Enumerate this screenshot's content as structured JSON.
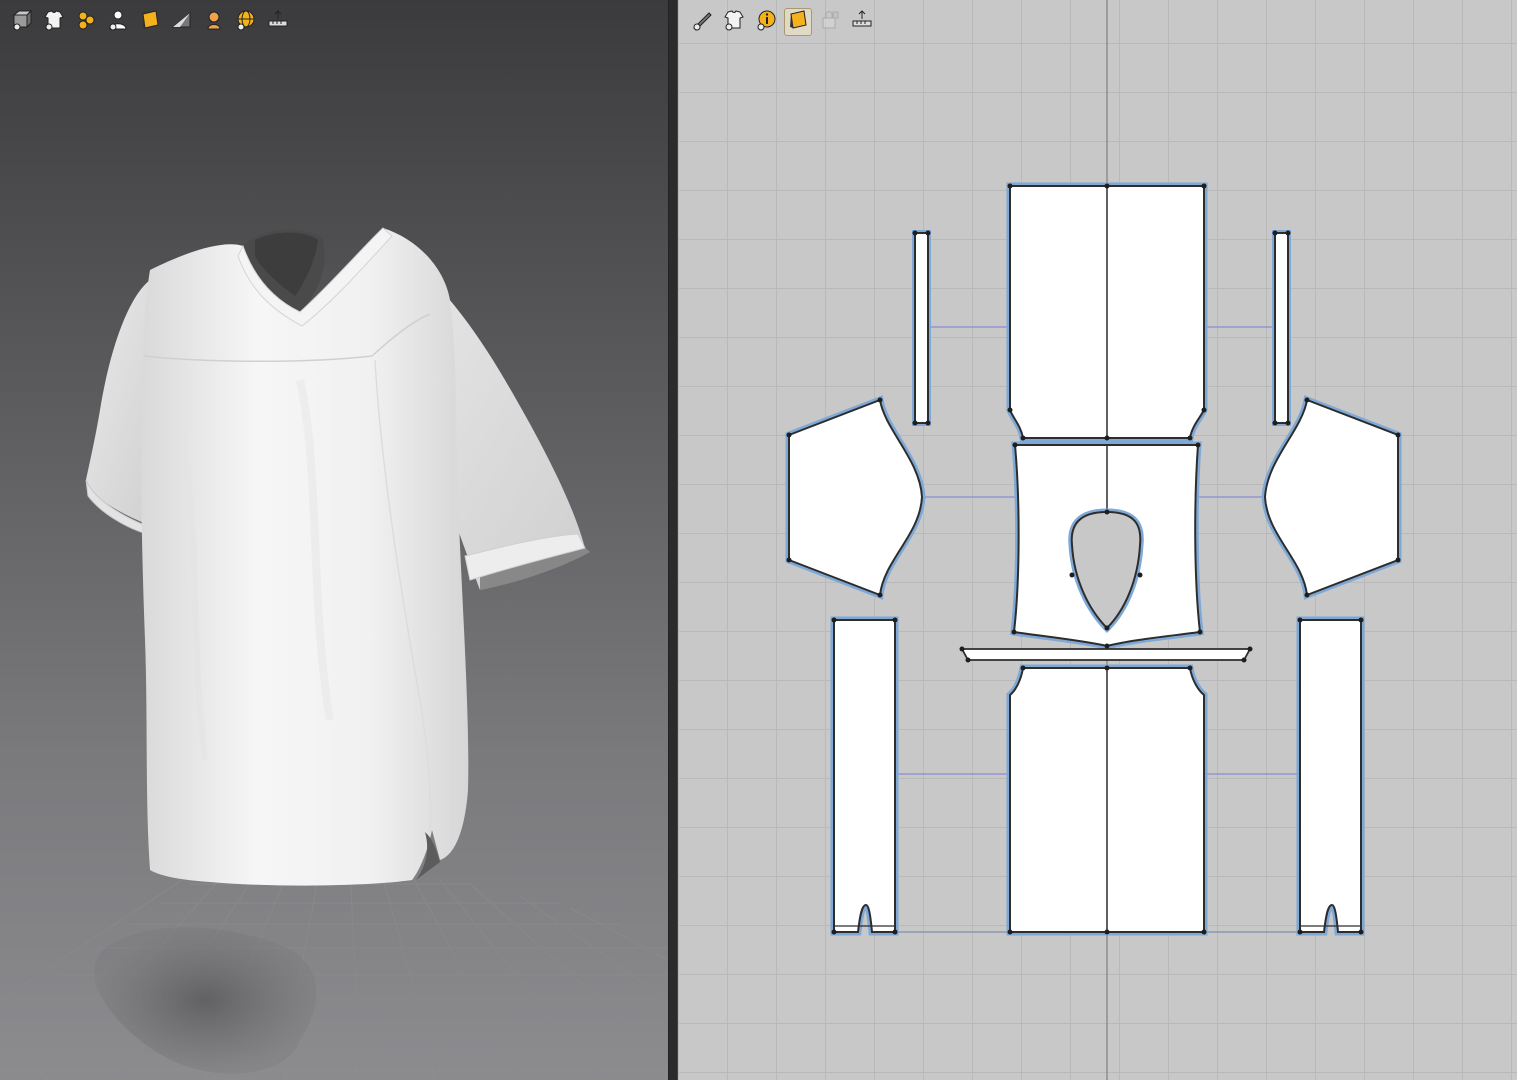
{
  "viewport_3d": {
    "toolbar": [
      {
        "icon": "cube-display-icon"
      },
      {
        "icon": "shirt-visibility-icon"
      },
      {
        "icon": "pin-points-icon"
      },
      {
        "icon": "avatar-visibility-icon"
      },
      {
        "icon": "texture-display-icon"
      },
      {
        "icon": "surface-render-icon"
      },
      {
        "icon": "avatar-head-icon"
      },
      {
        "icon": "wireframe-globe-icon"
      },
      {
        "icon": "ruler-measure-icon"
      }
    ],
    "background_color": "#5a5a5d",
    "garment_color": "#f2f2f2",
    "floor_grid": true
  },
  "pattern_window_2d": {
    "toolbar": [
      {
        "icon": "pattern-edit-icon",
        "active": false
      },
      {
        "icon": "pattern-visibility-icon",
        "active": false
      },
      {
        "icon": "info-icon",
        "active": false
      },
      {
        "icon": "texture-icon",
        "active": true
      },
      {
        "icon": "lock-pattern-icon",
        "active": false,
        "disabled": true
      },
      {
        "icon": "ruler-measure-icon",
        "active": false
      }
    ],
    "background_color": "#c8c8c8",
    "piece_fill": "#ffffff",
    "seam_outline_color": "#7ea8d6",
    "seam_link_color": "#8a8cd6",
    "grid": true
  }
}
